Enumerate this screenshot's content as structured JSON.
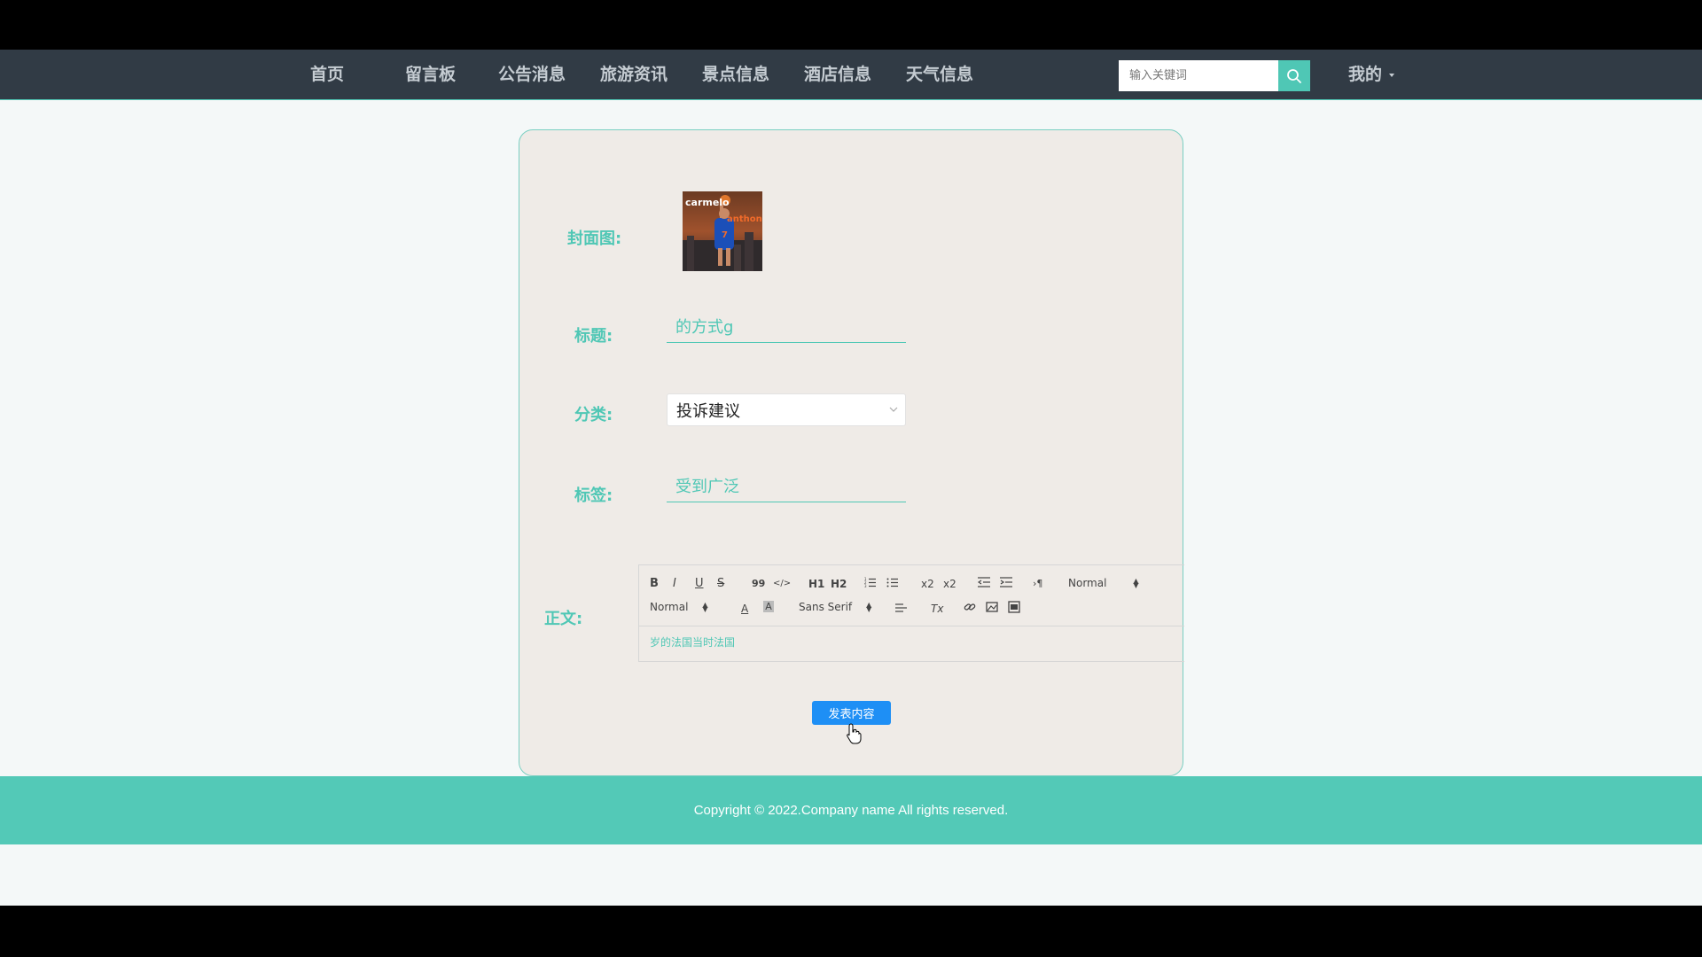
{
  "nav": {
    "items": [
      {
        "label": "首页"
      },
      {
        "label": "留言板"
      },
      {
        "label": "公告消息"
      },
      {
        "label": "旅游资讯"
      },
      {
        "label": "景点信息"
      },
      {
        "label": "酒店信息"
      },
      {
        "label": "天气信息"
      }
    ],
    "search_placeholder": "输入关键词",
    "search_value": "",
    "my_label": "我的"
  },
  "form": {
    "cover_label": "封面图:",
    "cover_image_text_top": "carmelo",
    "cover_image_text_mid": "anthony",
    "cover_image_jersey_number": "7",
    "title_label": "标题:",
    "title_value": "的方式g",
    "category_label": "分类:",
    "category_value": "投诉建议",
    "tags_label": "标签:",
    "tags_value": "受到广泛",
    "body_label": "正文:",
    "body_content": "岁的法国当时法国",
    "submit_label": "发表内容"
  },
  "editor_toolbar": {
    "bold": "B",
    "italic": "I",
    "underline": "U",
    "strike": "S",
    "blockquote": "99",
    "code": "</>",
    "h1": "H1",
    "h2": "H2",
    "ordered_list": "ordered-list-icon",
    "bullet_list": "bullet-list-icon",
    "subscript": "x2",
    "superscript": "x2",
    "outdent": "outdent-icon",
    "indent": "indent-icon",
    "rtl": "›¶",
    "header_select": "Normal",
    "size_select": "Normal",
    "font_select": "Sans Serif",
    "color": "A",
    "background": "A",
    "clean": "Tx"
  },
  "footer": {
    "copyright": "Copyright © 2022.Company name All rights reserved."
  },
  "colors": {
    "nav_bg": "#313b45",
    "accent": "#4fc7b5",
    "card_bg": "#efebe7",
    "primary_button": "#1e8ff5",
    "footer_bg": "#53c9b7"
  }
}
